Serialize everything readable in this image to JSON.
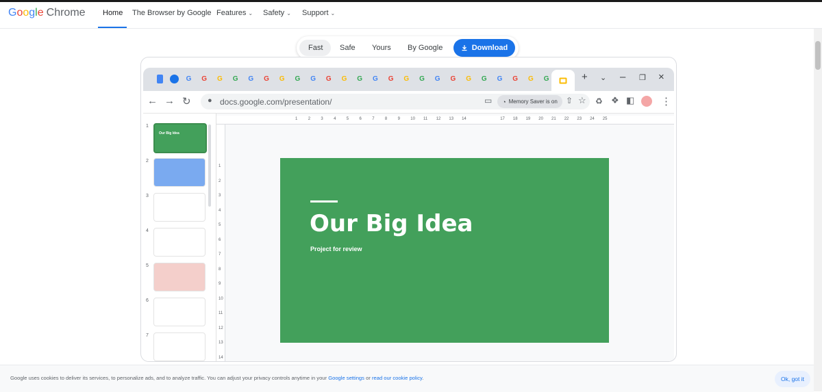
{
  "nav": {
    "logo_g": [
      "G",
      "o",
      "o",
      "g",
      "l",
      "e"
    ],
    "logo_chrome": "Chrome",
    "links": [
      "Home",
      "The Browser by Google",
      "Features",
      "Safety",
      "Support"
    ]
  },
  "pill": {
    "tabs": [
      "Fast",
      "Safe",
      "Yours",
      "By Google"
    ],
    "download": "Download"
  },
  "browser": {
    "url": "docs.google.com/presentation/",
    "memory_chip": "Memory Saver is on",
    "tab_letter": "G",
    "ruler_top": [
      "1",
      "2",
      "3",
      "4",
      "5",
      "6",
      "7",
      "8",
      "9",
      "10",
      "11",
      "12",
      "13",
      "14",
      "17",
      "18",
      "19",
      "20",
      "21",
      "22",
      "23",
      "24",
      "25"
    ],
    "ruler_left": [
      "1",
      "2",
      "3",
      "4",
      "5",
      "6",
      "7",
      "8",
      "9",
      "10",
      "11",
      "12",
      "13",
      "14"
    ]
  },
  "slides": {
    "thumb_numbers": [
      "1",
      "2",
      "3",
      "4",
      "5",
      "6",
      "7"
    ],
    "thumb1_title": "Our Big Idea"
  },
  "slide": {
    "title": "Our Big Idea",
    "subtitle": "Project for review"
  },
  "cookie": {
    "text": "Google uses cookies to deliver its services, to personalize ads, and to analyze traffic. You can adjust your privacy controls anytime in your",
    "link1": "Google settings",
    "or": "or",
    "link2": "read our cookie policy",
    "period": ".",
    "ok": "Ok, got it"
  },
  "colors": {
    "accent": "#1a73e8",
    "slide_green": "#43a05b"
  }
}
